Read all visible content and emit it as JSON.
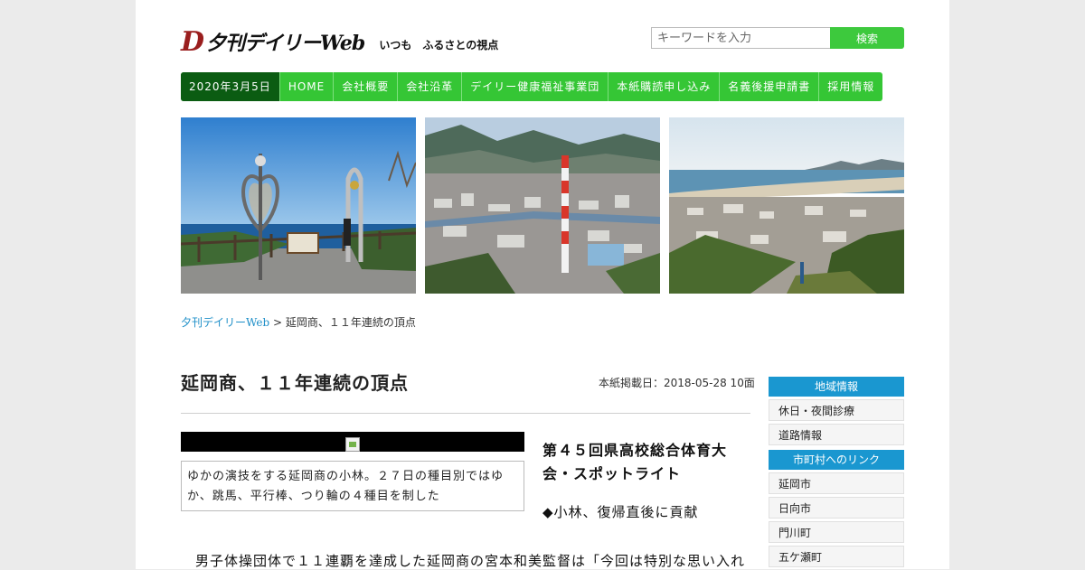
{
  "header": {
    "logo_mark": "D",
    "logo_name": "夕刊デイリーWeb",
    "tagline": "いつも　ふるさとの視点",
    "search_placeholder": "キーワードを入力",
    "search_button": "検索"
  },
  "nav": {
    "date": "2020年3月5日",
    "items": [
      "HOME",
      "会社概要",
      "会社沿革",
      "デイリー健康福祉事業団",
      "本紙購読申し込み",
      "名義後援申請書",
      "採用情報"
    ]
  },
  "breadcrumb": {
    "home": "夕刊デイリーWeb",
    "separator": " > ",
    "current": "延岡商、１１年連続の頂点"
  },
  "article": {
    "title": "延岡商、１１年連続の頂点",
    "date_label": "本紙掲載日：2018-05-28 10面",
    "caption": "ゆかの演技をする延岡商の小林。２７日の種目別ではゆか、跳馬、平行棒、つり輪の４種目を制した",
    "headline": "第４５回県高校総合体育大会・スポットライト",
    "subheadline": "◆小林、復帰直後に貢献",
    "body": "男子体操団体で１１連覇を達成した延岡商の宮本和美監督は「今回は特別な思い入れ"
  },
  "sidebar": {
    "section1_title": "地域情報",
    "section1_links": [
      "休日・夜間診療",
      "道路情報"
    ],
    "section2_title": "市町村へのリンク",
    "section2_links": [
      "延岡市",
      "日向市",
      "門川町",
      "五ケ瀬町"
    ]
  },
  "colors": {
    "nav_green": "#35c635",
    "date_green": "#0b5c12",
    "sidebar_blue": "#1a97d0",
    "link_blue": "#1e8fc8"
  }
}
